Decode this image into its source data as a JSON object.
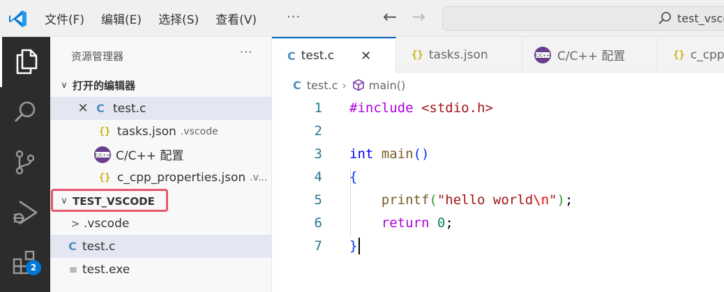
{
  "titlebar": {
    "menu": [
      "文件(F)",
      "编辑(E)",
      "选择(S)",
      "查看(V)"
    ],
    "more": "···",
    "back": "←",
    "forward": "→",
    "search_text": "test_vscode"
  },
  "activitybar": {
    "items": [
      "explorer",
      "search",
      "source-control",
      "run-and-debug",
      "extensions"
    ],
    "extensions_badge": "2",
    "active": "explorer"
  },
  "sidebar": {
    "title": "资源管理器",
    "more": "···",
    "open_editors": {
      "header": "打开的编辑器",
      "items": [
        {
          "icon": "C",
          "name": "test.c",
          "desc": "",
          "closable": true,
          "selected": true
        },
        {
          "icon": "{}",
          "name": "tasks.json",
          "desc": ".vscode"
        },
        {
          "icon": "C/C++",
          "name": "C/C++ 配置",
          "desc": ""
        },
        {
          "icon": "{}",
          "name": "c_cpp_properties.json",
          "desc": ".v..."
        }
      ]
    },
    "workspace": {
      "header": "TEST_VSCODE",
      "items": [
        {
          "icon": ">",
          "name": ".vscode"
        },
        {
          "icon": "C",
          "name": "test.c",
          "selected": true
        },
        {
          "icon": "≡",
          "name": "test.exe"
        }
      ]
    }
  },
  "tabs": [
    {
      "icon": "C",
      "label": "test.c",
      "active": true,
      "close": "✕"
    },
    {
      "icon": "{}",
      "label": "tasks.json"
    },
    {
      "icon": "C/C++",
      "label": "C/C++ 配置"
    },
    {
      "icon": "{}",
      "label": "c_cpp"
    }
  ],
  "breadcrumb": {
    "file_icon": "C",
    "file": "test.c",
    "separator": "›",
    "symbol": "main()"
  },
  "editor": {
    "line_numbers": [
      "1",
      "2",
      "3",
      "4",
      "5",
      "6",
      "7"
    ],
    "lines": [
      "#include <stdio.h>",
      "",
      "int main()",
      "{",
      "    printf(\"hello world\\n\");",
      "    return 0;",
      "}"
    ]
  },
  "colors": {
    "accent": "#005fb8",
    "activitybar": "#2c2c2c",
    "badge": "#0078d4",
    "highlight_box": "#e5566b"
  }
}
